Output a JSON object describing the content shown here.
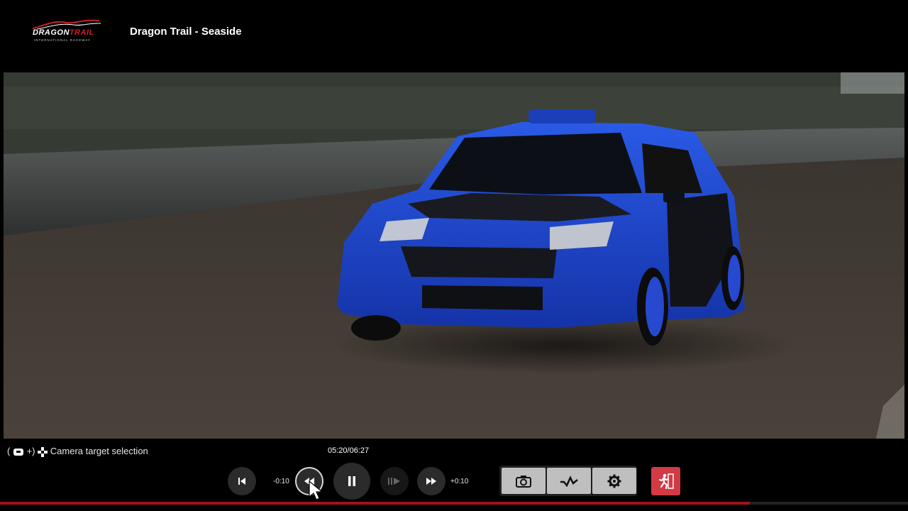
{
  "header": {
    "logo_text_main": "DRAGON",
    "logo_text_accent": "TRAIL",
    "logo_subtext": "INTERNATIONAL RACEWAY",
    "title": "Dragon Trail - Seaside"
  },
  "hint": {
    "prefix": "(",
    "plus": "+)",
    "label": "Camera target selection"
  },
  "playback": {
    "time": "05:20/06:27",
    "back_label": "-0:10",
    "forward_label": "+0:10",
    "progress": 0.826
  },
  "icons": {
    "skip_start": "skip-to-start-icon",
    "rewind": "rewind-icon",
    "pause": "pause-icon",
    "slow_forward": "slow-forward-icon",
    "fast_forward": "fast-forward-icon",
    "camera": "camera-icon",
    "graph": "telemetry-graph-icon",
    "settings": "gear-icon",
    "exit": "running-exit-icon"
  },
  "colors": {
    "accent_red": "#a0131d",
    "exit_button": "#d23a45",
    "car_blue": "#1e4fd6"
  }
}
